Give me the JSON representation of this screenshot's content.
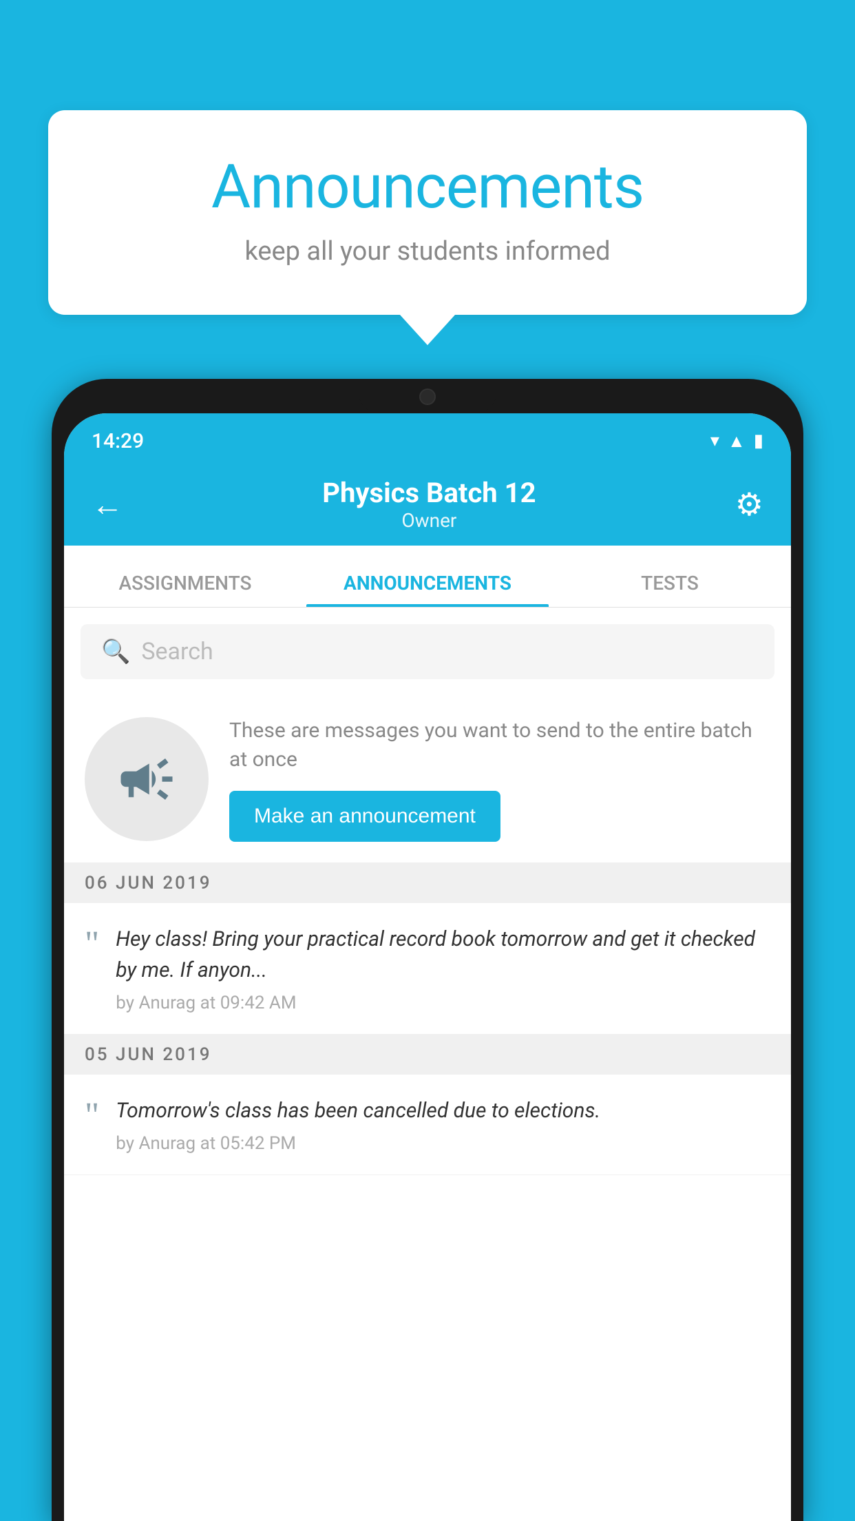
{
  "background_color": "#1ab5e0",
  "announcement_card": {
    "title": "Announcements",
    "subtitle": "keep all your students informed"
  },
  "phone": {
    "status_bar": {
      "time": "14:29",
      "icons": [
        "wifi",
        "signal",
        "battery"
      ]
    },
    "header": {
      "title": "Physics Batch 12",
      "subtitle": "Owner",
      "back_label": "←"
    },
    "tabs": [
      {
        "label": "ASSIGNMENTS",
        "active": false
      },
      {
        "label": "ANNOUNCEMENTS",
        "active": true
      },
      {
        "label": "TESTS",
        "active": false
      },
      {
        "label": "...",
        "active": false
      }
    ],
    "search": {
      "placeholder": "Search"
    },
    "promo": {
      "description": "These are messages you want to send to the entire batch at once",
      "button_label": "Make an announcement"
    },
    "date_groups": [
      {
        "date": "06  JUN  2019",
        "announcements": [
          {
            "text": "Hey class! Bring your practical record book tomorrow and get it checked by me. If anyon...",
            "meta": "by Anurag at 09:42 AM"
          }
        ]
      },
      {
        "date": "05  JUN  2019",
        "announcements": [
          {
            "text": "Tomorrow's class has been cancelled due to elections.",
            "meta": "by Anurag at 05:42 PM"
          }
        ]
      }
    ]
  }
}
